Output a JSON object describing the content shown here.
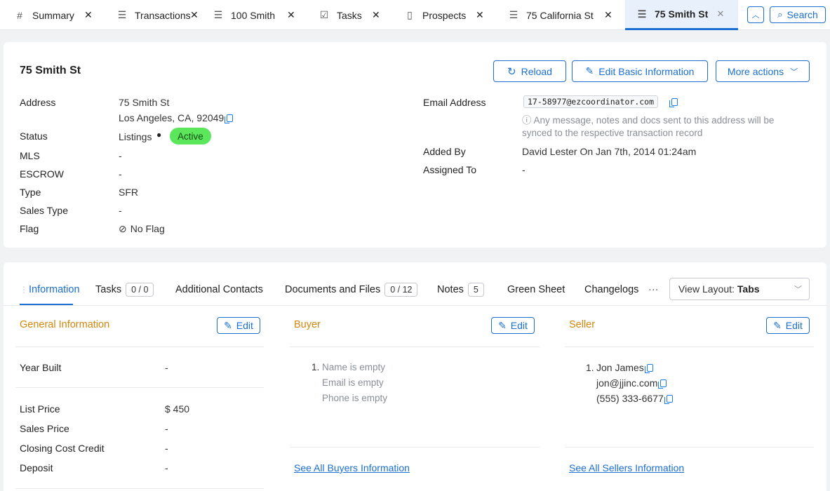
{
  "top_tabs": [
    {
      "label": "Summary",
      "icon": "hash-icon"
    },
    {
      "label": "Transactions",
      "icon": "list-icon"
    },
    {
      "label": "100 Smith",
      "icon": "list-icon"
    },
    {
      "label": "Tasks",
      "icon": "checkbox-icon"
    },
    {
      "label": "Prospects",
      "icon": "document-icon"
    },
    {
      "label": "75 California St",
      "icon": "list-icon"
    },
    {
      "label": "75 Smith St",
      "icon": "list-icon",
      "active": true
    }
  ],
  "topbar": {
    "search_label": "Search"
  },
  "record": {
    "title": "75 Smith St",
    "actions": {
      "reload": "Reload",
      "edit_basic": "Edit Basic Information",
      "more": "More actions"
    },
    "left_fields": {
      "address_label": "Address",
      "address_line1": "75 Smith St",
      "address_line2": "Los Angeles, CA, 92049",
      "status_label": "Status",
      "status_category": "Listings",
      "status_badge": "Active",
      "mls_label": "MLS",
      "mls_value": "-",
      "escrow_label": "ESCROW",
      "escrow_value": "-",
      "type_label": "Type",
      "type_value": "SFR",
      "sales_type_label": "Sales Type",
      "sales_type_value": "-",
      "flag_label": "Flag",
      "flag_value": "No Flag"
    },
    "right_fields": {
      "email_label": "Email Address",
      "email_value": "17-58977@ezcoordinator.com",
      "email_hint_line1": "Any message, notes and docs sent to this address will be",
      "email_hint_line2": "synced to the respective transaction record",
      "added_by_label": "Added By",
      "added_by_value": "David Lester On Jan 7th, 2014 01:24am",
      "assigned_label": "Assigned To",
      "assigned_value": "-"
    }
  },
  "section_tabs": {
    "information": "Information",
    "tasks": "Tasks",
    "tasks_count": "0 / 0",
    "contacts": "Additional Contacts",
    "documents": "Documents and Files",
    "documents_count": "0 / 12",
    "notes": "Notes",
    "notes_count": "5",
    "green_sheet": "Green Sheet",
    "changelogs": "Changelogs",
    "more": "···",
    "view_layout_label": "View Layout:",
    "view_layout_value": "Tabs"
  },
  "general": {
    "title": "General Information",
    "edit": "Edit",
    "year_built_label": "Year Built",
    "year_built_value": "-",
    "list_price_label": "List Price",
    "list_price_value": "$ 450",
    "sales_price_label": "Sales Price",
    "sales_price_value": "-",
    "closing_label": "Closing Cost Credit",
    "closing_value": "-",
    "deposit_label": "Deposit",
    "deposit_value": "-"
  },
  "buyer": {
    "title": "Buyer",
    "edit": "Edit",
    "index": "1.",
    "name": "Name is empty",
    "email": "Email is empty",
    "phone": "Phone is empty",
    "link": "See All Buyers Information"
  },
  "seller": {
    "title": "Seller",
    "edit": "Edit",
    "index": "1.",
    "name": "Jon James",
    "email": "jon@jjinc.com",
    "phone": "(555) 333-6677",
    "link": "See All Sellers Information"
  },
  "colors": {
    "accent": "#1a6fd1",
    "active_badge": "#5ce65c",
    "section_title": "#d4860b"
  }
}
